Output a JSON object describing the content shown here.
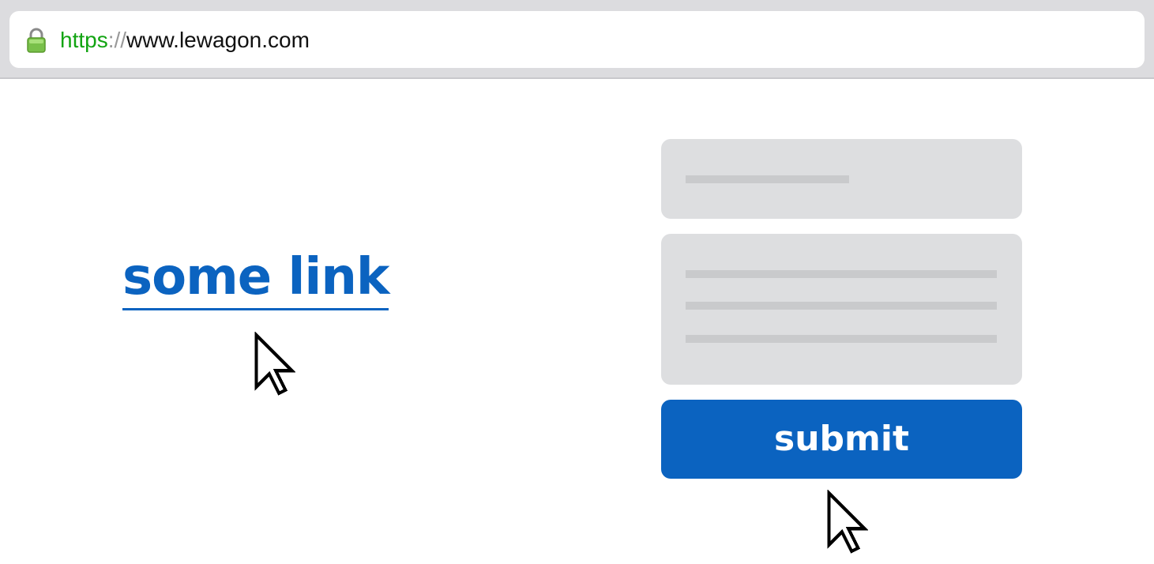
{
  "browser": {
    "url_scheme": "https",
    "url_separator": "://",
    "url_host": "www.lewagon.com",
    "lock_icon": "lock-icon"
  },
  "main": {
    "link_label": "some link",
    "submit_label": "submit",
    "cursor_icon": "arrow-cursor-icon"
  },
  "colors": {
    "link": "#0b63c0",
    "button": "#0b63c0",
    "url_scheme": "#12a412",
    "field_background": "#dddee0",
    "toolbar": "#dcdcdf"
  }
}
